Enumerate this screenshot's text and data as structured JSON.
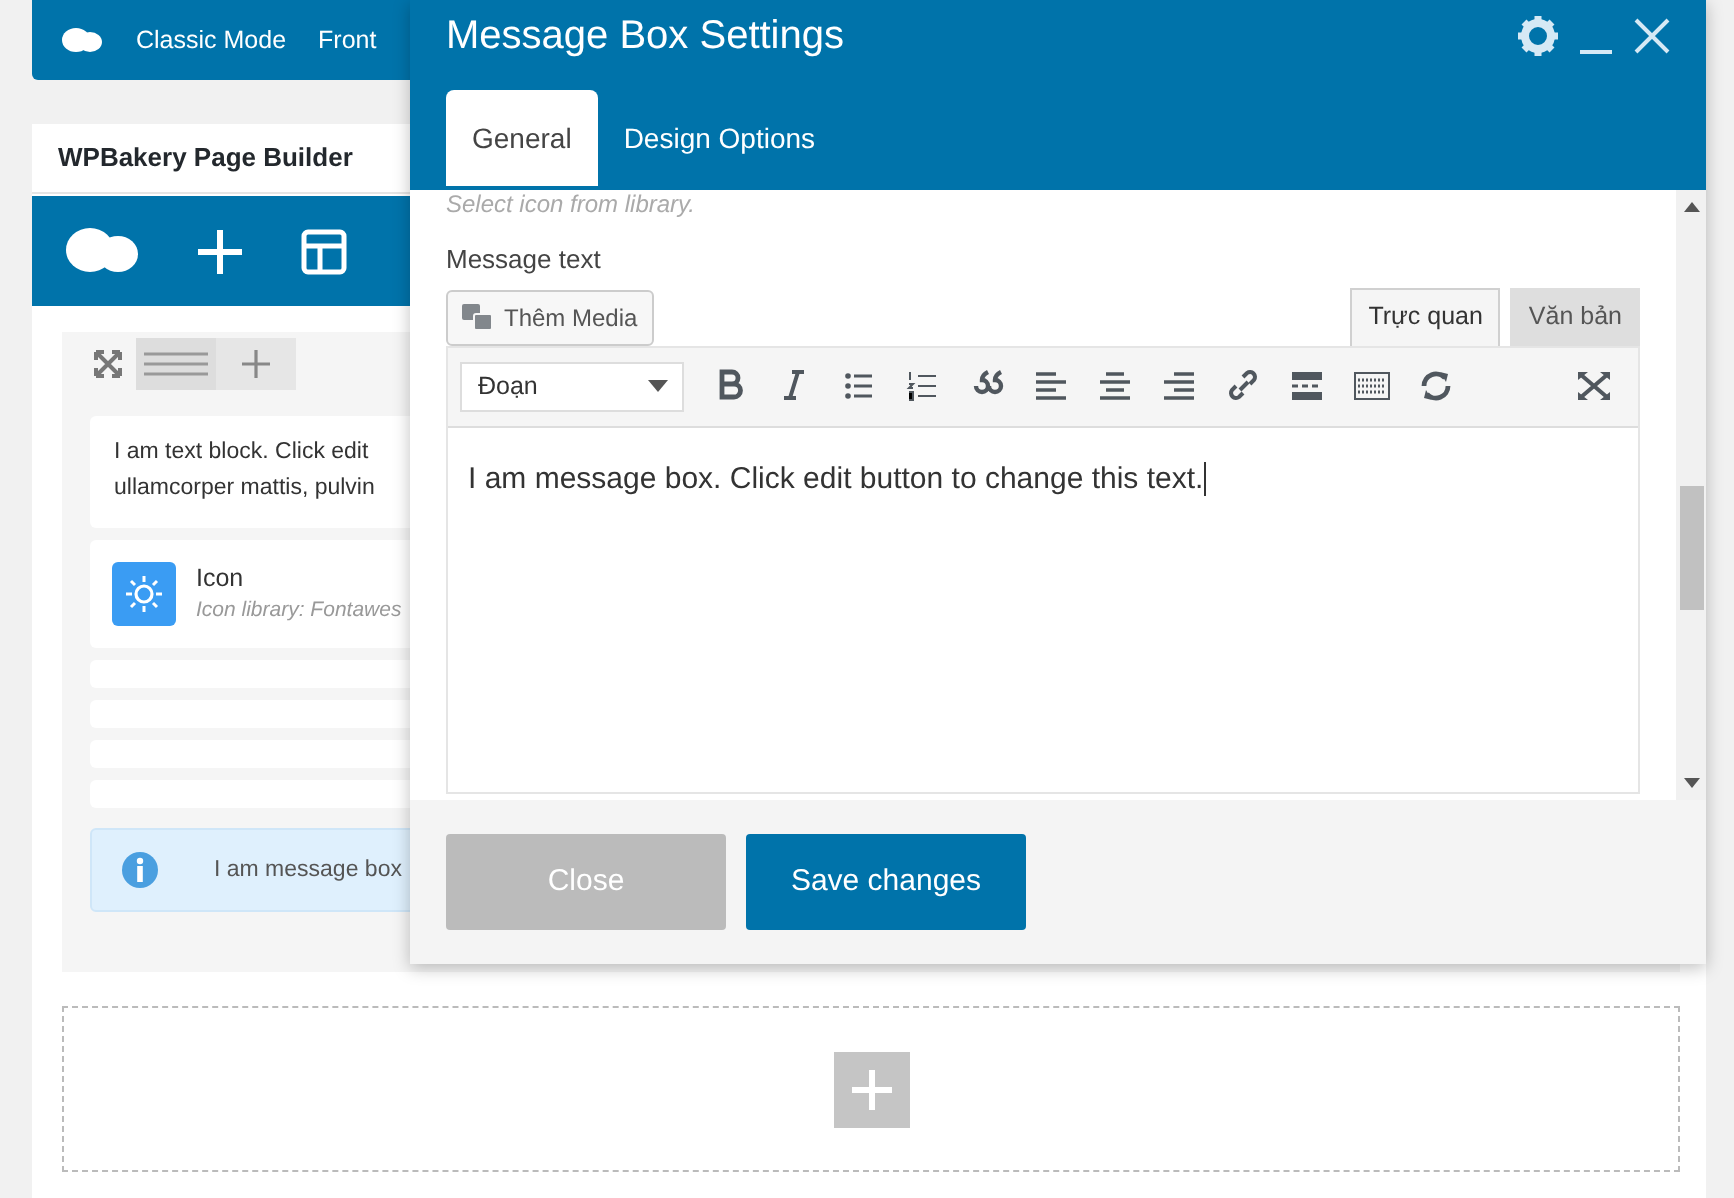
{
  "top_bar": {
    "items": [
      "Classic Mode",
      "Front"
    ]
  },
  "builder": {
    "title": "WPBakery Page Builder",
    "elements": [
      {
        "kind": "text",
        "lines": [
          "I am text block. Click edit",
          "ullamcorper mattis, pulvin"
        ]
      },
      {
        "kind": "icon",
        "title": "Icon",
        "subtitle": "Icon library: Fontawes"
      },
      {
        "kind": "empty"
      },
      {
        "kind": "empty"
      },
      {
        "kind": "empty"
      },
      {
        "kind": "empty"
      },
      {
        "kind": "message",
        "text": "I am message box"
      }
    ]
  },
  "modal": {
    "title": "Message Box Settings",
    "tabs": [
      {
        "label": "General",
        "selected": true
      },
      {
        "label": "Design Options",
        "selected": false
      }
    ],
    "hint": "Select icon from library.",
    "field_label": "Message text",
    "media_button": "Thêm Media",
    "editor_tabs": [
      {
        "label": "Trực quan",
        "selected": true
      },
      {
        "label": "Văn bản",
        "selected": false
      }
    ],
    "format_select": "Đoạn",
    "content": "I am message box. Click edit button to change this text.",
    "buttons": [
      {
        "label": "Close",
        "kind": "secondary"
      },
      {
        "label": "Save changes",
        "kind": "primary"
      }
    ]
  }
}
